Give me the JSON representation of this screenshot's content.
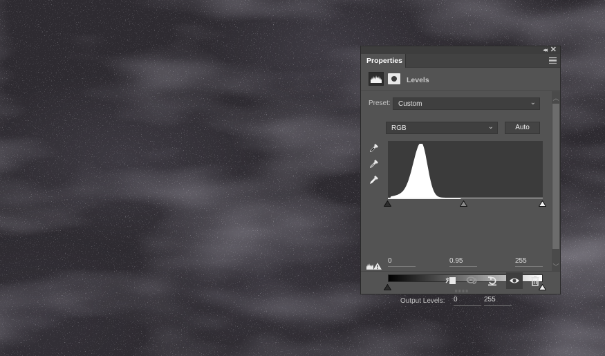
{
  "panel": {
    "tab_label": "Properties",
    "adjustment_type": "Levels",
    "icons": {
      "collapse": "double-chevron-left-icon",
      "close": "close-icon",
      "menu": "panel-menu-icon",
      "levels": "levels-histogram-icon",
      "mask": "layer-mask-icon"
    }
  },
  "levels": {
    "preset_label": "Preset:",
    "preset_value": "Custom",
    "channel_value": "RGB",
    "auto_label": "Auto",
    "eyedroppers": [
      "black-point-eyedropper-icon",
      "gray-point-eyedropper-icon",
      "white-point-eyedropper-icon"
    ],
    "input_levels": {
      "black": "0",
      "gamma": "0.95",
      "white": "255"
    },
    "output_label": "Output Levels:",
    "output_levels": {
      "black": "0",
      "white": "255"
    },
    "histogram_peak_level": 55,
    "histogram_range": [
      5,
      115
    ]
  },
  "footer": {
    "buttons": [
      {
        "name": "clip-to-layer-button",
        "icon": "clip-to-layer-icon"
      },
      {
        "name": "view-previous-state-button",
        "icon": "view-previous-state-icon"
      },
      {
        "name": "reset-button",
        "icon": "reset-icon"
      },
      {
        "name": "toggle-visibility-button",
        "icon": "eye-icon",
        "active": true
      },
      {
        "name": "delete-button",
        "icon": "trash-icon"
      }
    ]
  },
  "colors": {
    "panel_bg": "#535353",
    "histogram_bg": "#3b3b3b",
    "histogram_fill": "#ffffff",
    "canvas_bg": "#2e2b31"
  }
}
